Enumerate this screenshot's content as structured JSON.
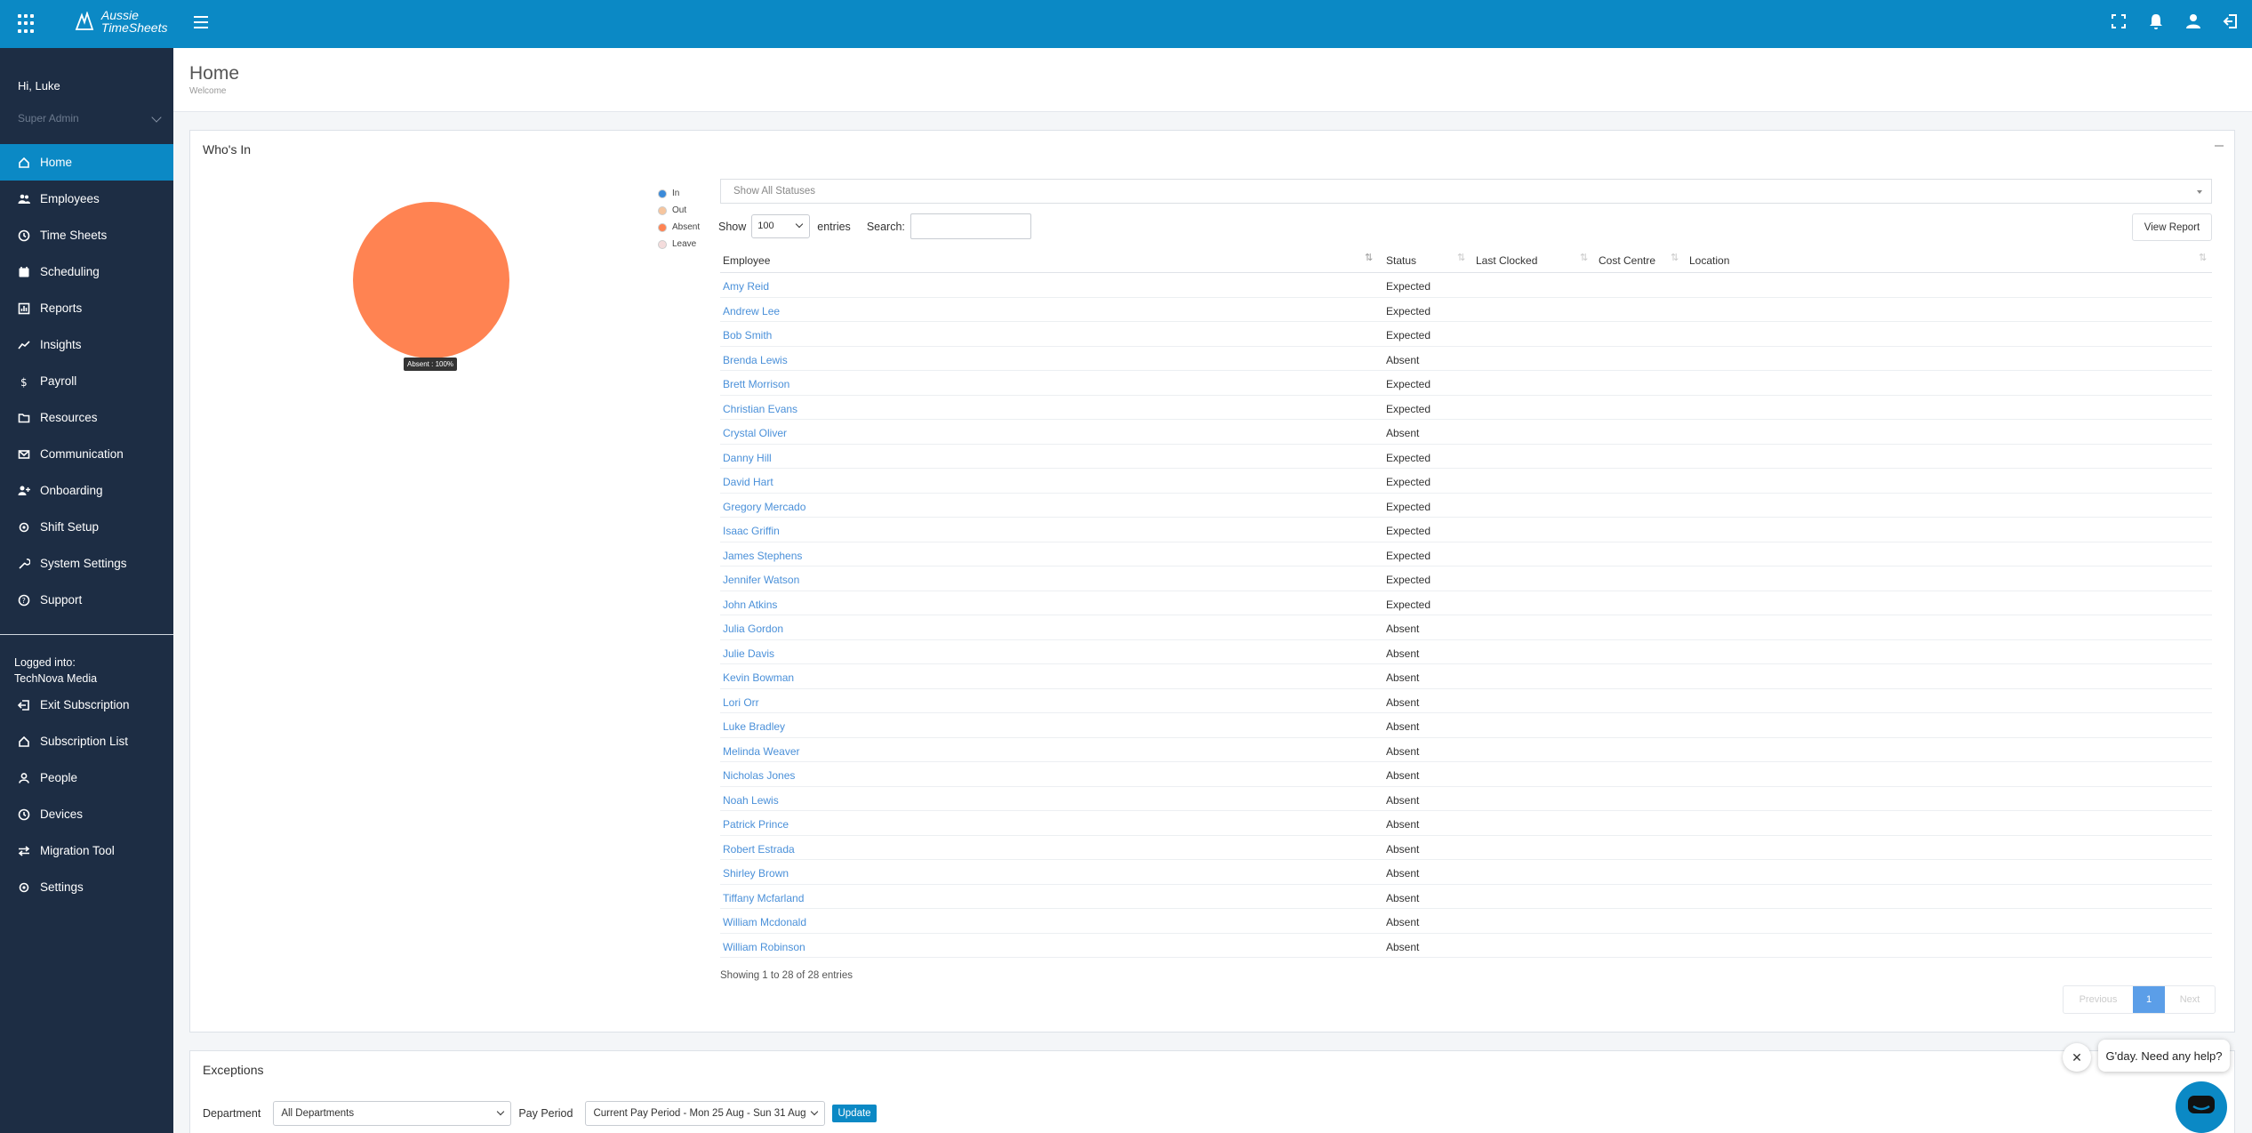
{
  "header": {
    "logo_line1": "Aussie",
    "logo_line2": "TimeSheets"
  },
  "sidebar": {
    "greeting": "Hi, Luke",
    "role": "Super Admin",
    "items": [
      {
        "label": "Home",
        "icon": "home-icon"
      },
      {
        "label": "Employees",
        "icon": "users-icon"
      },
      {
        "label": "Time Sheets",
        "icon": "clock-icon"
      },
      {
        "label": "Scheduling",
        "icon": "calendar-icon"
      },
      {
        "label": "Reports",
        "icon": "bar-chart-icon"
      },
      {
        "label": "Insights",
        "icon": "trend-icon"
      },
      {
        "label": "Payroll",
        "icon": "dollar-icon"
      },
      {
        "label": "Resources",
        "icon": "folder-icon"
      },
      {
        "label": "Communication",
        "icon": "envelope-icon"
      },
      {
        "label": "Onboarding",
        "icon": "user-plus-icon"
      },
      {
        "label": "Shift Setup",
        "icon": "gear-icon"
      },
      {
        "label": "System Settings",
        "icon": "wrench-icon"
      },
      {
        "label": "Support",
        "icon": "question-icon"
      }
    ],
    "logged_into_label": "Logged into:",
    "company": "TechNova Media",
    "items2": [
      {
        "label": "Exit Subscription",
        "icon": "exit-icon"
      },
      {
        "label": "Subscription List",
        "icon": "home-icon"
      },
      {
        "label": "People",
        "icon": "person-icon"
      },
      {
        "label": "Devices",
        "icon": "clock-icon"
      },
      {
        "label": "Migration Tool",
        "icon": "swap-icon"
      },
      {
        "label": "Settings",
        "icon": "gear-icon"
      }
    ]
  },
  "page": {
    "title": "Home",
    "subtitle": "Welcome"
  },
  "whos_in": {
    "title": "Who's In",
    "chart_tooltip": "Absent : 100%",
    "legend": [
      {
        "label": "In",
        "color": "#3b8ad9"
      },
      {
        "label": "Out",
        "color": "#f6c59e"
      },
      {
        "label": "Absent",
        "color": "#ff8352"
      },
      {
        "label": "Leave",
        "color": "#f4dcdc"
      }
    ],
    "status_filter": "Show All Statuses",
    "show_label": "Show",
    "entries_value": "100",
    "entries_label": "entries",
    "search_label": "Search:",
    "view_report": "View Report",
    "columns": [
      "Employee",
      "Status",
      "Last Clocked",
      "Cost Centre",
      "Location"
    ],
    "rows": [
      {
        "employee": "Amy Reid",
        "status": "Expected"
      },
      {
        "employee": "Andrew Lee",
        "status": "Expected"
      },
      {
        "employee": "Bob Smith",
        "status": "Expected"
      },
      {
        "employee": "Brenda Lewis",
        "status": "Absent"
      },
      {
        "employee": "Brett Morrison",
        "status": "Expected"
      },
      {
        "employee": "Christian Evans",
        "status": "Expected"
      },
      {
        "employee": "Crystal Oliver",
        "status": "Absent"
      },
      {
        "employee": "Danny Hill",
        "status": "Expected"
      },
      {
        "employee": "David Hart",
        "status": "Expected"
      },
      {
        "employee": "Gregory Mercado",
        "status": "Expected"
      },
      {
        "employee": "Isaac Griffin",
        "status": "Expected"
      },
      {
        "employee": "James Stephens",
        "status": "Expected"
      },
      {
        "employee": "Jennifer Watson",
        "status": "Expected"
      },
      {
        "employee": "John Atkins",
        "status": "Expected"
      },
      {
        "employee": "Julia Gordon",
        "status": "Absent"
      },
      {
        "employee": "Julie Davis",
        "status": "Absent"
      },
      {
        "employee": "Kevin Bowman",
        "status": "Absent"
      },
      {
        "employee": "Lori Orr",
        "status": "Absent"
      },
      {
        "employee": "Luke Bradley",
        "status": "Absent"
      },
      {
        "employee": "Melinda Weaver",
        "status": "Absent"
      },
      {
        "employee": "Nicholas Jones",
        "status": "Absent"
      },
      {
        "employee": "Noah Lewis",
        "status": "Absent"
      },
      {
        "employee": "Patrick Prince",
        "status": "Absent"
      },
      {
        "employee": "Robert Estrada",
        "status": "Absent"
      },
      {
        "employee": "Shirley Brown",
        "status": "Absent"
      },
      {
        "employee": "Tiffany Mcfarland",
        "status": "Absent"
      },
      {
        "employee": "William Mcdonald",
        "status": "Absent"
      },
      {
        "employee": "William Robinson",
        "status": "Absent"
      }
    ],
    "showing": "Showing 1 to 28 of 28 entries",
    "pagination": {
      "previous": "Previous",
      "page": "1",
      "next": "Next"
    }
  },
  "chart_data": {
    "type": "pie",
    "categories": [
      "In",
      "Out",
      "Absent",
      "Leave"
    ],
    "values": [
      0,
      0,
      100,
      0
    ],
    "colors": [
      "#3b8ad9",
      "#f6c59e",
      "#ff8352",
      "#f4dcdc"
    ]
  },
  "exceptions": {
    "title": "Exceptions",
    "department_label": "Department",
    "department_value": "All Departments",
    "pay_period_label": "Pay Period",
    "pay_period_value": "Current Pay Period - Mon 25 Aug - Sun 31 Aug",
    "update": "Update"
  },
  "chat": {
    "message": "G'day. Need any help?"
  }
}
